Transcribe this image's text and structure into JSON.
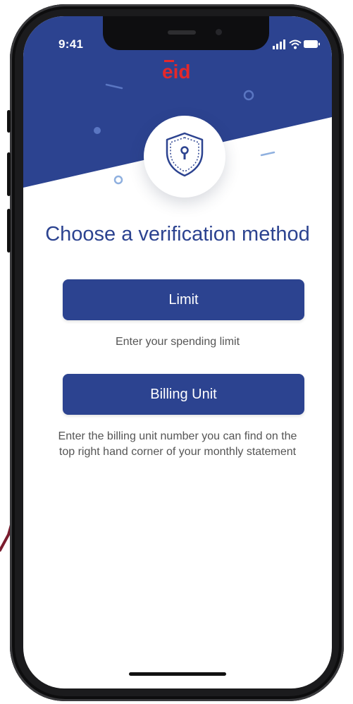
{
  "status_bar": {
    "time": "9:41"
  },
  "brand": {
    "logo_text": "eid",
    "accent_color": "#e5282a",
    "primary_color": "#2c4390"
  },
  "header": {
    "icon": "shield-keyhole-icon"
  },
  "title": "Choose a verification method",
  "options": [
    {
      "label": "Limit",
      "description": "Enter your spending limit"
    },
    {
      "label": "Billing Unit",
      "description": "Enter the billing unit number you can find on the top right hand corner of your monthly statement"
    }
  ]
}
